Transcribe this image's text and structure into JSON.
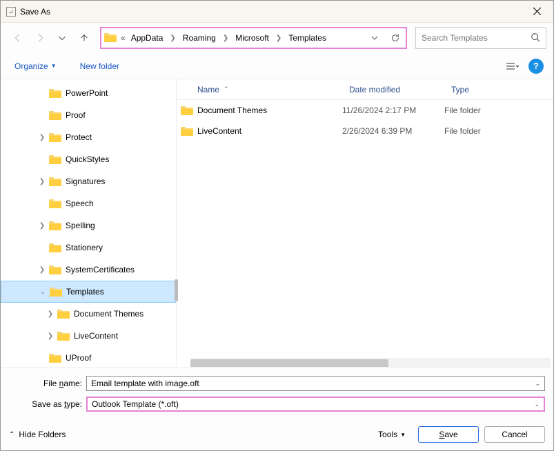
{
  "window": {
    "title": "Save As"
  },
  "breadcrumb": {
    "prefix": "«",
    "segments": [
      "AppData",
      "Roaming",
      "Microsoft",
      "Templates"
    ]
  },
  "search": {
    "placeholder": "Search Templates"
  },
  "toolbar": {
    "organize": "Organize",
    "new_folder": "New folder"
  },
  "tree": [
    {
      "level": 1,
      "expand": "",
      "label": "PowerPoint"
    },
    {
      "level": 1,
      "expand": "",
      "label": "Proof"
    },
    {
      "level": 1,
      "expand": ">",
      "label": "Protect"
    },
    {
      "level": 1,
      "expand": "",
      "label": "QuickStyles"
    },
    {
      "level": 1,
      "expand": ">",
      "label": "Signatures"
    },
    {
      "level": 1,
      "expand": "",
      "label": "Speech"
    },
    {
      "level": 1,
      "expand": ">",
      "label": "Spelling"
    },
    {
      "level": 1,
      "expand": "",
      "label": "Stationery"
    },
    {
      "level": 1,
      "expand": ">",
      "label": "SystemCertificates"
    },
    {
      "level": 1,
      "expand": "v",
      "label": "Templates",
      "selected": true
    },
    {
      "level": 3,
      "expand": ">",
      "label": "Document Themes"
    },
    {
      "level": 3,
      "expand": ">",
      "label": "LiveContent"
    },
    {
      "level": 1,
      "expand": "",
      "label": "UProof"
    }
  ],
  "list": {
    "columns": {
      "name": "Name",
      "date": "Date modified",
      "type": "Type"
    },
    "rows": [
      {
        "name": "Document Themes",
        "date": "11/26/2024 2:17 PM",
        "type": "File folder"
      },
      {
        "name": "LiveContent",
        "date": "2/26/2024 6:39 PM",
        "type": "File folder"
      }
    ]
  },
  "form": {
    "filename_label_pre": "File ",
    "filename_label_ul": "n",
    "filename_label_post": "ame:",
    "filename_value": "Email template with image.oft",
    "type_label_pre": "Save as ",
    "type_label_ul": "t",
    "type_label_post": "ype:",
    "type_value": "Outlook Template (*.oft)"
  },
  "footer": {
    "hide": "Hide Folders",
    "tools_pre": "Too",
    "tools_ul": "l",
    "tools_post": "s",
    "save_ul": "S",
    "save_post": "ave",
    "cancel": "Cancel"
  }
}
